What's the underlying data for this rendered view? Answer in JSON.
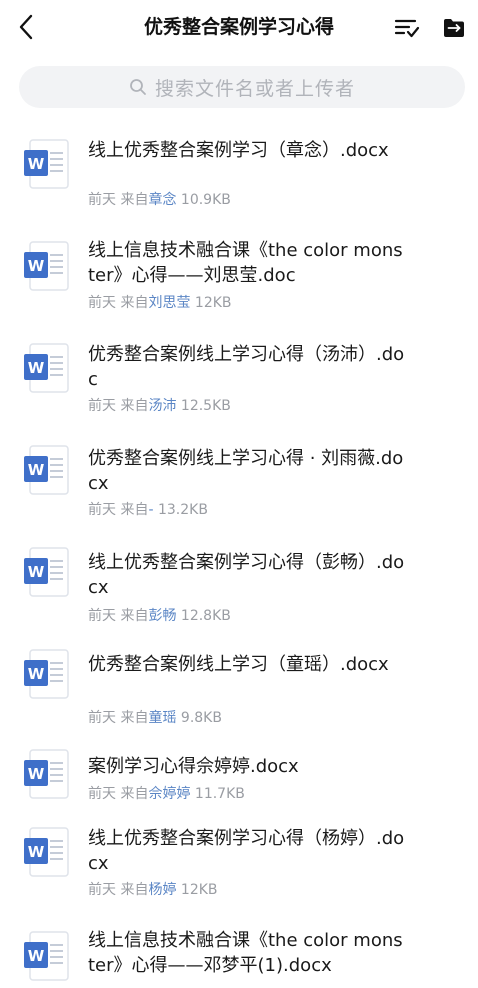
{
  "header": {
    "title": "优秀整合案例学习心得"
  },
  "search": {
    "placeholder": "搜索文件名或者上传者"
  },
  "files": [
    {
      "name": "线上优秀整合案例学习（章念）.docx",
      "time": "前天",
      "from_label": "来自",
      "sender": "章念",
      "size": "10.9KB"
    },
    {
      "name": "线上信息技术融合课《the color monster》心得——刘思莹.doc",
      "time": "前天",
      "from_label": "来自",
      "sender": "刘思莹",
      "size": "12KB"
    },
    {
      "name": "优秀整合案例线上学习心得（汤沛）.doc",
      "time": "前天",
      "from_label": "来自",
      "sender": "汤沛",
      "size": "12.5KB"
    },
    {
      "name": "优秀整合案例线上学习心得 · 刘雨薇.docx",
      "time": "前天",
      "from_label": "来自",
      "sender": "-",
      "size": "13.2KB"
    },
    {
      "name": "线上优秀整合案例学习心得（彭畅）.docx",
      "time": "前天",
      "from_label": "来自",
      "sender": "彭畅",
      "size": "12.8KB"
    },
    {
      "name": "优秀整合案例线上学习（童瑶）.docx",
      "time": "前天",
      "from_label": "来自",
      "sender": "童瑶",
      "size": "9.8KB"
    },
    {
      "name": "案例学习心得佘婷婷.docx",
      "time": "前天",
      "from_label": "来自",
      "sender": "佘婷婷",
      "size": "11.7KB"
    },
    {
      "name": "线上优秀整合案例学习心得（杨婷）.docx",
      "time": "前天",
      "from_label": "来自",
      "sender": "杨婷",
      "size": "12KB"
    },
    {
      "name": "线上信息技术融合课《the color monster》心得——邓梦平(1).docx",
      "time": "",
      "from_label": "",
      "sender": "",
      "size": ""
    }
  ],
  "colors": {
    "word_icon_blue": "#3f6fc9",
    "sender_link": "#5b86c5",
    "meta_grey": "#9a9da3",
    "search_bg": "#f2f3f5"
  },
  "icons": {
    "back": "chevron-left-icon",
    "sort": "sort-list-icon",
    "folder": "folder-icon",
    "search": "search-icon",
    "file": "word-doc-icon"
  }
}
